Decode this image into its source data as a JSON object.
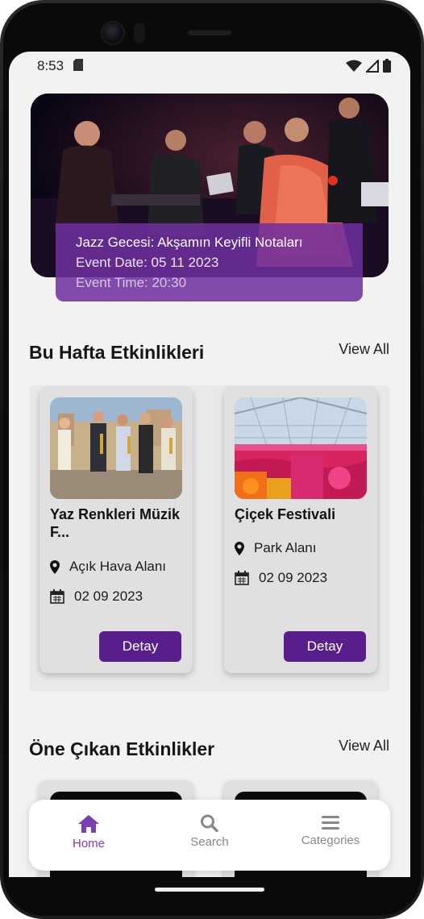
{
  "status_bar": {
    "time": "8:53"
  },
  "hero": {
    "title": "Jazz Gecesi: Akşamın Keyifli Notaları",
    "event_date": "Event Date: 05 11 2023",
    "event_time": "Event Time: 20:30"
  },
  "this_week": {
    "title": "Bu Hafta Etkinlikleri",
    "view_all": "View All",
    "cards": [
      {
        "title": "Yaz Renkleri Müzik F...",
        "location": "Açık Hava Alanı",
        "date": "02 09 2023",
        "button": "Detay"
      },
      {
        "title": "Çiçek Festivali",
        "location": "Park Alanı",
        "date": "02 09 2023",
        "button": "Detay"
      }
    ]
  },
  "featured": {
    "title": "Öne Çıkan Etkinlikler",
    "view_all": "View All"
  },
  "bottom_nav": {
    "items": [
      {
        "label": "Home",
        "icon": "home-icon"
      },
      {
        "label": "Search",
        "icon": "search-icon"
      },
      {
        "label": "Categories",
        "icon": "menu-icon"
      }
    ],
    "active": "Home"
  },
  "colors": {
    "accent": "#5a1e8c",
    "overlay": "#7030a0",
    "active_nav": "#7a3fb0",
    "background": "#f2f2f2"
  }
}
